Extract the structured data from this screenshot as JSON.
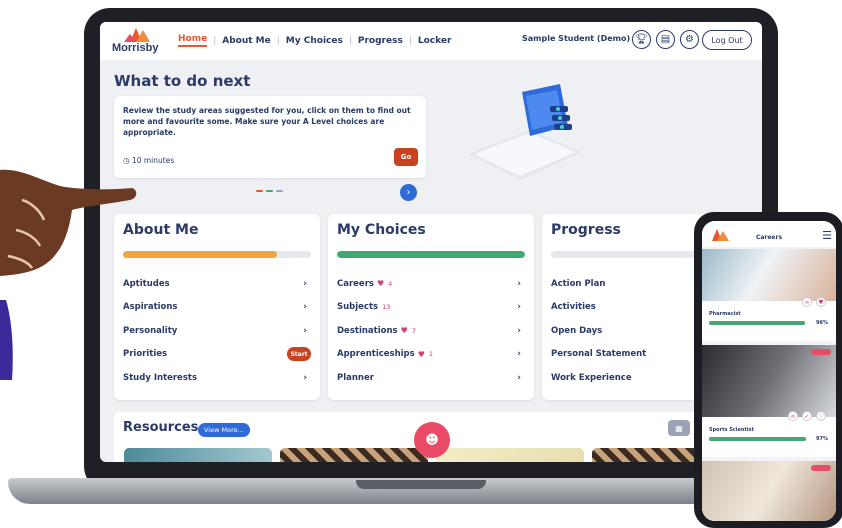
{
  "app": {
    "logo_text": "Morrisby",
    "nav": [
      {
        "label": "Home",
        "active": true
      },
      {
        "label": "About Me"
      },
      {
        "label": "My Choices"
      },
      {
        "label": "Progress"
      },
      {
        "label": "Locker"
      }
    ],
    "student_name": "Sample Student (Demo)",
    "logout_label": "Log Out",
    "brand_colors": {
      "navy": "#2b3a67",
      "orange": "#e8572e",
      "green": "#43a86f",
      "blue": "#2e6bd8",
      "pink": "#e94b66"
    }
  },
  "next": {
    "heading": "What to do next",
    "description": "Review the study areas suggested for you, click on them to find out more and favourite some. Make sure your A Level choices are appropriate.",
    "duration": "10 minutes",
    "go_label": "Go"
  },
  "panels": {
    "about": {
      "title": "About Me",
      "progress": 0.82,
      "items": [
        "Aptitudes",
        "Aspirations",
        "Personality",
        "Priorities",
        "Study Interests"
      ],
      "priorities_badge": "Start"
    },
    "choices": {
      "title": "My Choices",
      "progress": 1.0,
      "items": [
        {
          "label": "Careers",
          "count": "4",
          "heart": true
        },
        {
          "label": "Subjects",
          "count": "13",
          "heart": false
        },
        {
          "label": "Destinations",
          "count": "7",
          "heart": true
        },
        {
          "label": "Apprenticeships",
          "count": "1",
          "heart": true
        },
        {
          "label": "Planner",
          "count": "",
          "heart": false
        }
      ]
    },
    "progress": {
      "title": "Progress",
      "progress": 0.0,
      "items": [
        "Action Plan",
        "Activities",
        "Open Days",
        "Personal Statement",
        "Work Experience"
      ]
    }
  },
  "resources": {
    "title": "Resources",
    "view_more": "View More..."
  },
  "phone": {
    "title": "Careers",
    "cards": [
      {
        "label": "Pharmacist",
        "percent": "96%",
        "match": 0.96
      },
      {
        "label": "Sports Scientist",
        "percent": "97%",
        "match": 0.97
      }
    ]
  }
}
